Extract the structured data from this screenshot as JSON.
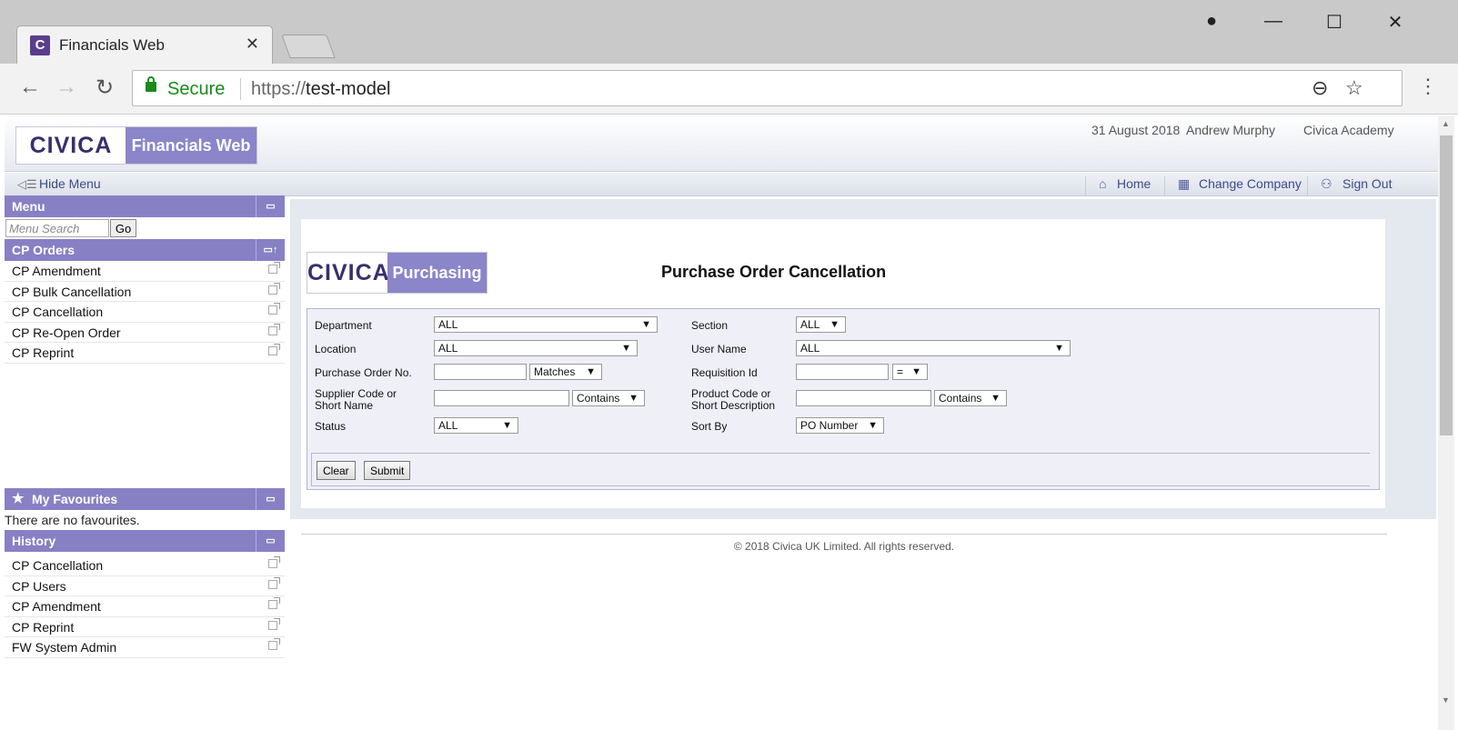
{
  "browser": {
    "tab_title": "Financials Web",
    "tab_favicon": "C",
    "close_glyph": "✕",
    "secure_label": "Secure",
    "url_scheme": "https://",
    "url_host": "test-model"
  },
  "header": {
    "logo_text": "CIVICA",
    "app_name": "Financials Web",
    "date": "31 August 2018",
    "user": "Andrew Murphy",
    "company": "Civica Academy"
  },
  "navbar": {
    "hide_menu": "Hide Menu",
    "home": "Home",
    "change_company": "Change Company",
    "sign_out": "Sign Out"
  },
  "sidebar": {
    "menu_title": "Menu",
    "search_placeholder": "Menu Search",
    "go_label": "Go",
    "section_title": "CP Orders",
    "items": [
      {
        "label": "CP Amendment"
      },
      {
        "label": "CP Bulk Cancellation"
      },
      {
        "label": "CP Cancellation"
      },
      {
        "label": "CP Re-Open Order"
      },
      {
        "label": "CP Reprint"
      }
    ],
    "favourites_title": "My Favourites",
    "favourites_empty": "There are no favourites.",
    "history_title": "History",
    "history": [
      {
        "label": "CP Cancellation"
      },
      {
        "label": "CP Users"
      },
      {
        "label": "CP Amendment"
      },
      {
        "label": "CP Reprint"
      },
      {
        "label": "FW System Admin"
      }
    ]
  },
  "main": {
    "module_logo": "CIVICA",
    "module_name": "Purchasing",
    "title": "Purchase Order Cancellation",
    "form": {
      "department_label": "Department",
      "department_value": "ALL",
      "section_label": "Section",
      "section_value": "ALL",
      "location_label": "Location",
      "location_value": "ALL",
      "username_label": "User Name",
      "username_value": "ALL",
      "po_label": "Purchase Order No.",
      "po_value": "",
      "po_match": "Matches",
      "req_label": "Requisition Id",
      "req_value": "",
      "req_match": "=",
      "supplier_label_1": "Supplier Code or",
      "supplier_label_2": "Short Name",
      "supplier_value": "",
      "supplier_match": "Contains",
      "product_label_1": "Product Code or",
      "product_label_2": "Short Description",
      "product_value": "",
      "product_match": "Contains",
      "status_label": "Status",
      "status_value": "ALL",
      "sortby_label": "Sort By",
      "sortby_value": "PO Number"
    },
    "clear_label": "Clear",
    "submit_label": "Submit"
  },
  "footer": "© 2018 Civica UK Limited. All rights reserved."
}
